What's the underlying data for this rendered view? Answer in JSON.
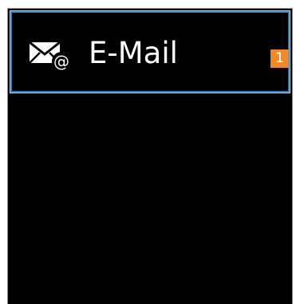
{
  "menu": {
    "items": [
      {
        "label": "E-Mail",
        "icon": "email-at-icon",
        "unread_count": "1",
        "focused": true
      }
    ]
  },
  "colors": {
    "background": "#000000",
    "focus_border": "#2e7fc2",
    "badge": "#ee8a2a",
    "text": "#ffffff"
  }
}
